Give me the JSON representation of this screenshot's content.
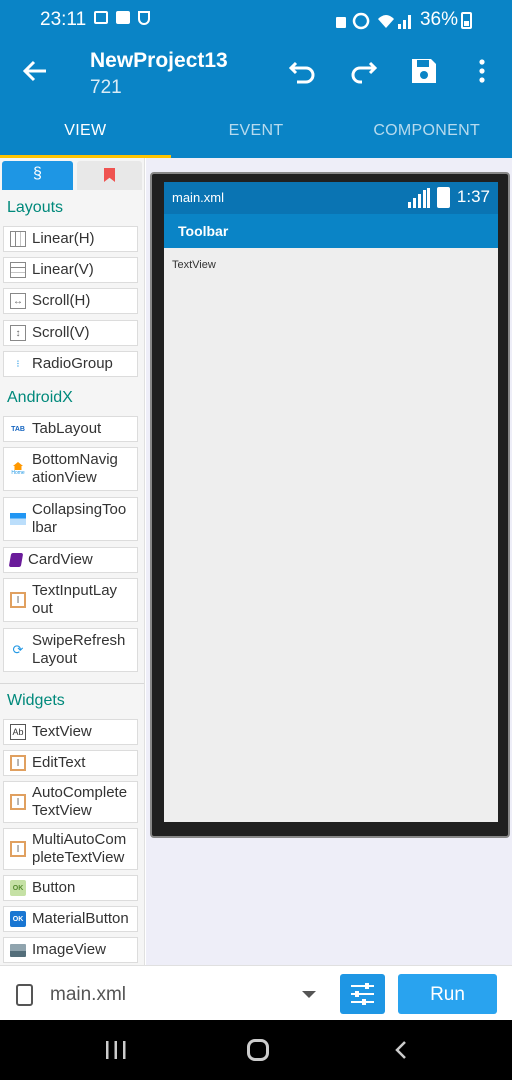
{
  "status_bar": {
    "time": "23:11",
    "battery": "36%"
  },
  "app_bar": {
    "title": "NewProject13",
    "subtitle": "721",
    "tabs": [
      {
        "label": "VIEW",
        "active": true
      },
      {
        "label": "EVENT",
        "active": false
      },
      {
        "label": "COMPONENT",
        "active": false
      }
    ]
  },
  "palette": {
    "active_tab_symbol": "§",
    "sections": [
      {
        "title": "Layouts",
        "items": [
          "Linear(H)",
          "Linear(V)",
          "Scroll(H)",
          "Scroll(V)",
          "RadioGroup"
        ]
      },
      {
        "title": "AndroidX",
        "items": [
          "TabLayout",
          "BottomNavigationView",
          "CollapsingToolbar",
          "CardView",
          "TextInputLayout",
          "SwipeRefreshLayout"
        ]
      },
      {
        "title": "Widgets",
        "items": [
          "TextView",
          "EditText",
          "AutoCompleteTextView",
          "MultiAutoCompleteTextView",
          "Button",
          "MaterialButton",
          "ImageView"
        ]
      }
    ],
    "labels": {
      "linear_h": "Linear(H)",
      "linear_v": "Linear(V)",
      "scroll_h": "Scroll(H)",
      "scroll_v": "Scroll(V)",
      "radiogroup": "RadioGroup",
      "tablayout": "TabLayout",
      "bottomnav_1": "BottomNavig",
      "bottomnav_2": "ationView",
      "collapsing_1": "CollapsingToo",
      "collapsing_2": "lbar",
      "cardview": "CardView",
      "textinput_1": "TextInputLay",
      "textinput_2": "out",
      "swipe_1": "SwipeRefresh",
      "swipe_2": "Layout",
      "textview": "TextView",
      "edittext": "EditText",
      "autocomplete_1": "AutoComplete",
      "autocomplete_2": "TextView",
      "multiauto_1": "MultiAutoCom",
      "multiauto_2": "pleteTextView",
      "button": "Button",
      "materialbutton": "MaterialButton",
      "imageview": "ImageView"
    },
    "icon_labels": {
      "tab": "TAB",
      "home": "Home",
      "ab": "Ab",
      "ok": "OK"
    }
  },
  "preview": {
    "file": "main.xml",
    "time": "1:37",
    "toolbar_title": "Toolbar",
    "textview_text": "TextView"
  },
  "bottom_bar": {
    "file_name": "main.xml",
    "run_label": "Run"
  },
  "colors": {
    "primary": "#0a84c6",
    "accent": "#ffc400",
    "section_title": "#00897b"
  }
}
